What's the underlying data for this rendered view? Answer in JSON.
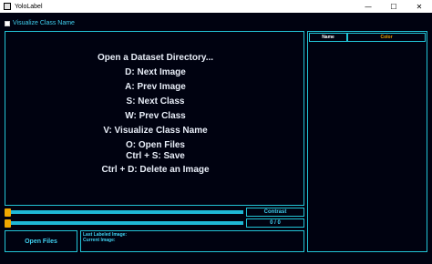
{
  "window": {
    "title": "YoloLabel",
    "minimize_glyph": "—",
    "maximize_glyph": "☐",
    "close_glyph": "✕"
  },
  "visualize_checkbox": {
    "label": "Visualize Class Name",
    "checked": false
  },
  "help_lines": [
    "Open a Dataset Directory...",
    "D: Next Image",
    "A: Prev Image",
    "S: Next Class",
    "W: Prev Class",
    "V: Visualize Class Name",
    "O: Open Files",
    "Ctrl + S: Save",
    "Ctrl + D: Delete an Image"
  ],
  "class_table": {
    "headers": [
      "Name",
      "Color"
    ],
    "rows": []
  },
  "contrast": {
    "label": "Contrast",
    "value_fraction": 0.0
  },
  "image_progress": {
    "label": "0 / 0",
    "value_fraction": 0.0
  },
  "open_files_label": "Open Files",
  "info": {
    "last_labeled": "Last Labeled Image:",
    "current": "Current Image:"
  },
  "colors": {
    "background": "#000210",
    "accent": "#22c4d6",
    "thumb": "#f0a800",
    "header_color": "#e9a000"
  }
}
